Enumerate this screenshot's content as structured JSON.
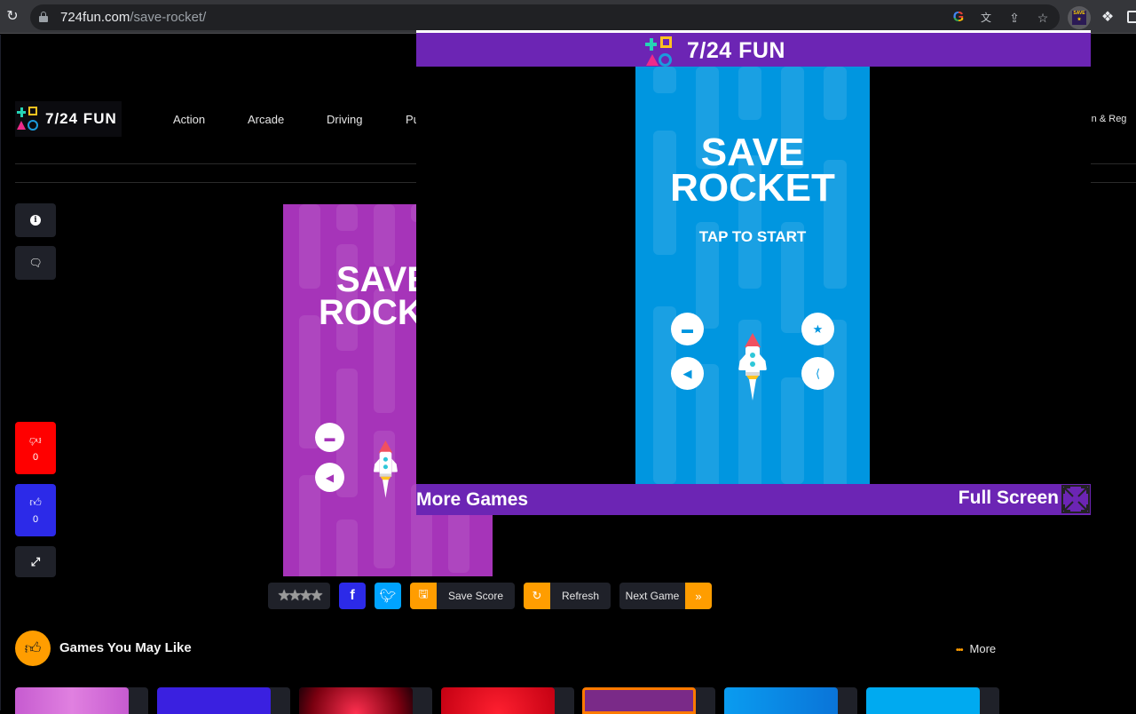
{
  "browser": {
    "url_domain": "724fun.com",
    "url_path": "/save-rocket/",
    "icons": [
      "reload-icon",
      "lock-icon",
      "google-icon",
      "translate-icon",
      "share-icon",
      "bookmark-star-icon",
      "save-extension-icon",
      "extensions-puzzle-icon",
      "side-panel-icon"
    ]
  },
  "site": {
    "logo_text": "7/24 FUN",
    "nav": [
      "Action",
      "Arcade",
      "Driving",
      "Pu"
    ],
    "login": "ogin & Reg"
  },
  "side_actions": {
    "dislike_count": "0",
    "like_count": "0"
  },
  "game": {
    "title_line1": "SAVE",
    "title_line2": "ROCKET",
    "tap_to_start": "TAP TO START",
    "purple_title_line1": "SAVE",
    "purple_title_line2": "ROCK"
  },
  "toolbar": {
    "rating_stars": "★★★★",
    "facebook": "f",
    "save_score": "Save Score",
    "refresh": "Refresh",
    "next_game": "Next Game",
    "next_chevron": "»"
  },
  "games_you_may_like": {
    "title": "Games You May Like",
    "more": "More",
    "more_dots": "•••",
    "cards": [
      {
        "color": "#c65bd0"
      },
      {
        "color": "#3a20e0"
      },
      {
        "color": "#b0001a"
      },
      {
        "color": "#c40012"
      },
      {
        "color": "#7a2a88"
      },
      {
        "color": "#0a84e8"
      },
      {
        "color": "#00aaf0"
      }
    ]
  },
  "overlay": {
    "header_title": "7/24 FUN",
    "more_games": "More Games",
    "full_screen": "Full Screen"
  },
  "colors": {
    "overlay_purple": "#6c25b4",
    "game_blue": "#0096e0",
    "game_purple": "#a634b9",
    "accent_orange": "#ff9d00",
    "dislike_red": "#ff0000",
    "like_blue": "#2c2ae8"
  }
}
